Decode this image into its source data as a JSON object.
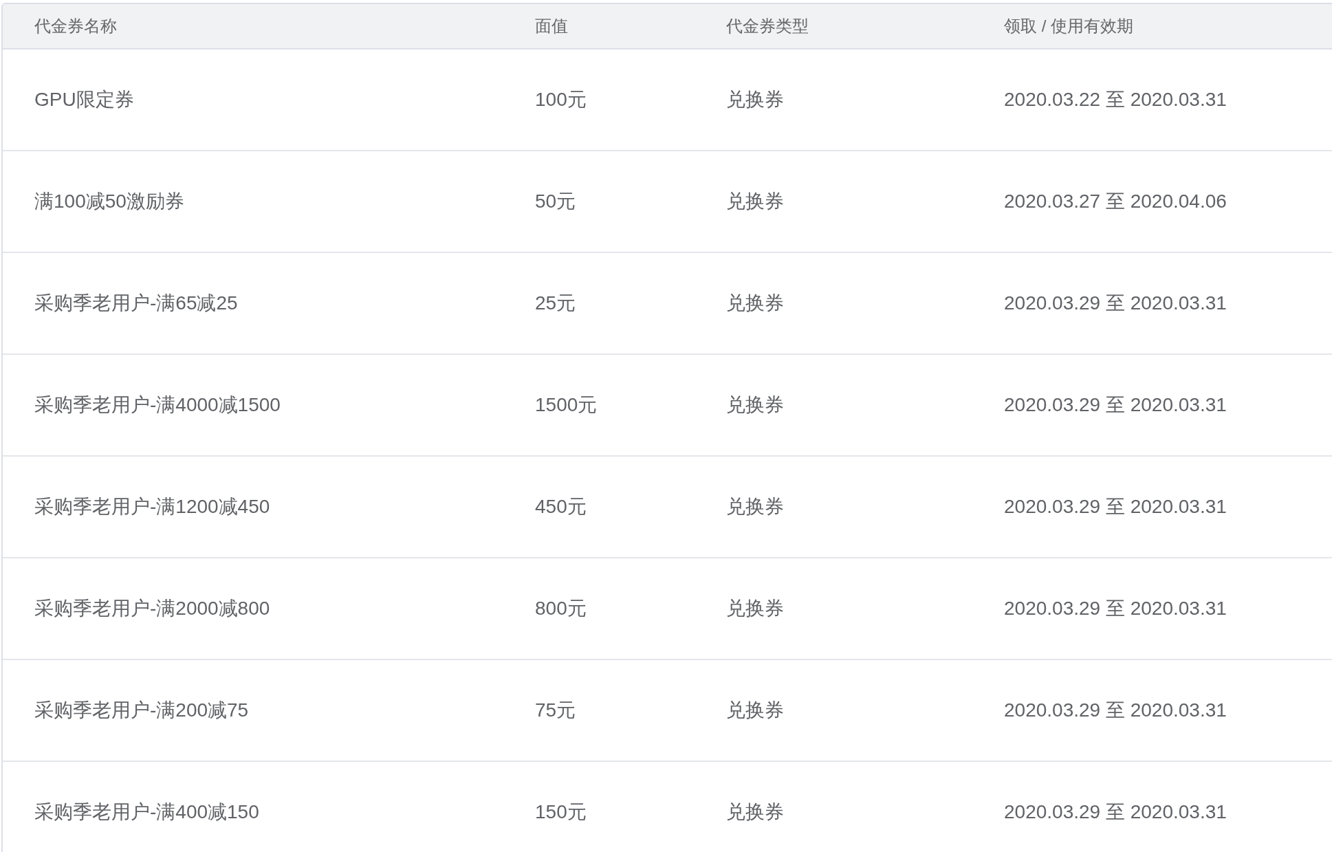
{
  "table": {
    "columns": [
      "代金券名称",
      "面值",
      "代金券类型",
      "领取 / 使用有效期"
    ],
    "rows": [
      {
        "name": "GPU限定券",
        "value": "100元",
        "type": "兑换券",
        "validity": "2020.03.22 至 2020.03.31"
      },
      {
        "name": "满100减50激励券",
        "value": "50元",
        "type": "兑换券",
        "validity": "2020.03.27 至 2020.04.06"
      },
      {
        "name": "采购季老用户-满65减25",
        "value": "25元",
        "type": "兑换券",
        "validity": "2020.03.29 至 2020.03.31"
      },
      {
        "name": "采购季老用户-满4000减1500",
        "value": "1500元",
        "type": "兑换券",
        "validity": "2020.03.29 至 2020.03.31"
      },
      {
        "name": "采购季老用户-满1200减450",
        "value": "450元",
        "type": "兑换券",
        "validity": "2020.03.29 至 2020.03.31"
      },
      {
        "name": "采购季老用户-满2000减800",
        "value": "800元",
        "type": "兑换券",
        "validity": "2020.03.29 至 2020.03.31"
      },
      {
        "name": "采购季老用户-满200减75",
        "value": "75元",
        "type": "兑换券",
        "validity": "2020.03.29 至 2020.03.31"
      },
      {
        "name": "采购季老用户-满400减150",
        "value": "150元",
        "type": "兑换券",
        "validity": "2020.03.29 至 2020.03.31"
      }
    ]
  }
}
